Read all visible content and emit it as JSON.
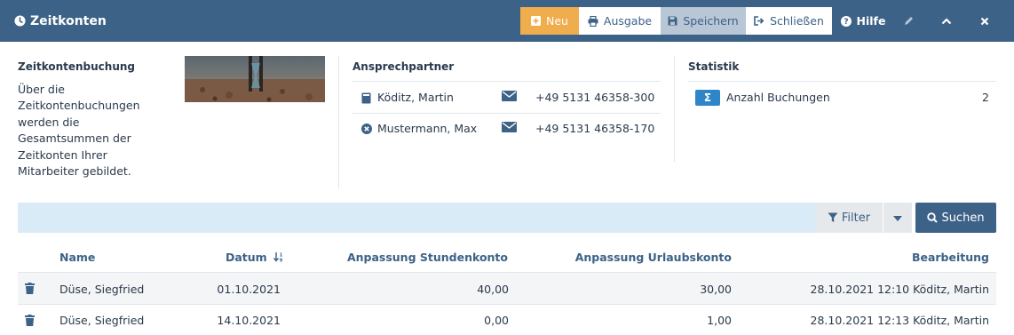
{
  "header": {
    "title": "Zeitkonten",
    "buttons": {
      "new": "Neu",
      "print": "Ausgabe",
      "save": "Speichern",
      "close": "Schließen",
      "help": "Hilfe"
    }
  },
  "info": {
    "title": "Zeitkontenbuchung",
    "description": "Über die Zeitkontenbuchungen werden die Gesamtsummen der Zeitkonten Ihrer Mitarbeiter gebildet."
  },
  "contacts": {
    "title": "Ansprechpartner",
    "items": [
      {
        "name": "Köditz, Martin",
        "phone": "+49 5131 46358-300",
        "icon": "book-icon"
      },
      {
        "name": "Mustermann, Max",
        "phone": "+49 5131 46358-170",
        "icon": "cancel-circle-icon"
      }
    ]
  },
  "stats": {
    "title": "Statistik",
    "badge": "Σ",
    "label": "Anzahl Buchungen",
    "value": "2"
  },
  "search": {
    "filter_label": "Filter",
    "search_label": "Suchen"
  },
  "table": {
    "columns": [
      "Name",
      "Datum",
      "Anpassung Stundenkonto",
      "Anpassung Urlaubskonto",
      "Bearbeitung"
    ],
    "rows": [
      {
        "name": "Düse, Siegfried",
        "date": "01.10.2021",
        "hours": "40,00",
        "vacation": "30,00",
        "edit": "28.10.2021 12:10 Köditz, Martin"
      },
      {
        "name": "Düse, Siegfried",
        "date": "14.10.2021",
        "hours": "0,00",
        "vacation": "1,00",
        "edit": "28.10.2021 12:13 Köditz, Martin"
      }
    ]
  },
  "colors": {
    "header_bg": "#3d6287",
    "new_button": "#f0ad4e",
    "badge": "#2e86c8",
    "searchbar": "#d9ebf6"
  }
}
